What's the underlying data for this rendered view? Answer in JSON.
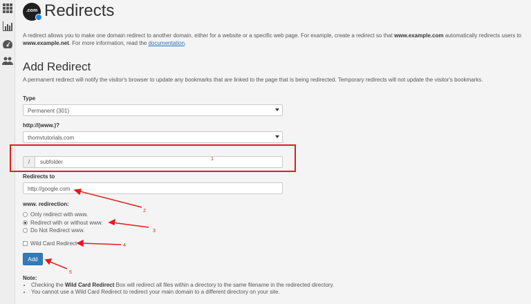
{
  "sidebar": {
    "icons": [
      "grid-icon",
      "chart-icon",
      "dashboard-icon",
      "users-icon"
    ]
  },
  "header": {
    "logo_text": ".com",
    "title": "Redirects"
  },
  "intro": {
    "text1": "A redirect allows you to make one domain redirect to another domain, either for a website or a specific web page. For example, create a redirect so that ",
    "bold1": "www.example.com",
    "text2": " automatically redirects users to ",
    "bold2": "www.example.net",
    "text3": ". For more information, read the ",
    "link": "documentation",
    "text4": "."
  },
  "add_redirect": {
    "title": "Add Redirect",
    "description": "A permanent redirect will notify the visitor's browser to update any bookmarks that are linked to the page that is being redirected. Temporary redirects will not update the visitor's bookmarks.",
    "type_label": "Type",
    "type_value": "Permanent (301)",
    "domain_label": "http://(www.)?",
    "domain_value": "thomvtutorials.com",
    "path_prefix": "/",
    "path_value": "subfolder",
    "redirects_to_label": "Redirects to",
    "redirects_to_value": "http://google.com",
    "www_label": "www. redirection:",
    "www_options": [
      "Only redirect with www.",
      "Redirect with or without www.",
      "Do Not Redirect www."
    ],
    "www_selected": 1,
    "wildcard_label": "Wild Card Redirect",
    "add_button": "Add"
  },
  "note": {
    "title": "Note:",
    "item1_a": "Checking the ",
    "item1_b": "Wild Card Redirect",
    "item1_c": " Box will redirect all files within a directory to the same filename in the redirected directory.",
    "item2": "You cannot use a Wild Card Redirect to redirect your main domain to a different directory on your site."
  },
  "annotations": {
    "n1": "1",
    "n2": "2",
    "n3": "3",
    "n4": "4",
    "n5": "5",
    "color": "#e11c1c"
  }
}
